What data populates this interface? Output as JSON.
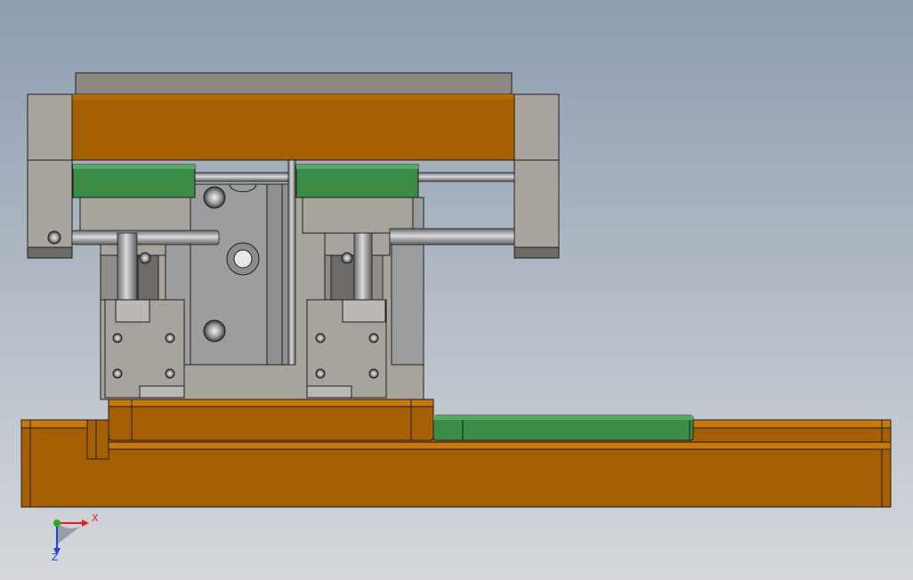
{
  "viewport": {
    "background_top": "#8d9db0",
    "background_bottom": "#d6d8dc"
  },
  "colors": {
    "orange": "#a35f00",
    "orange_light": "#c8790c",
    "green": "#3a8c46",
    "gray": "#a9a39d",
    "gray_dark": "#6e6a67",
    "steel": "#9c9d9f",
    "outline": "#1f1f1f"
  },
  "triad": {
    "x_label": "X",
    "z_label": "Z",
    "x_color": "#e02020",
    "y_color": "#20b020",
    "z_color": "#2040e0"
  }
}
